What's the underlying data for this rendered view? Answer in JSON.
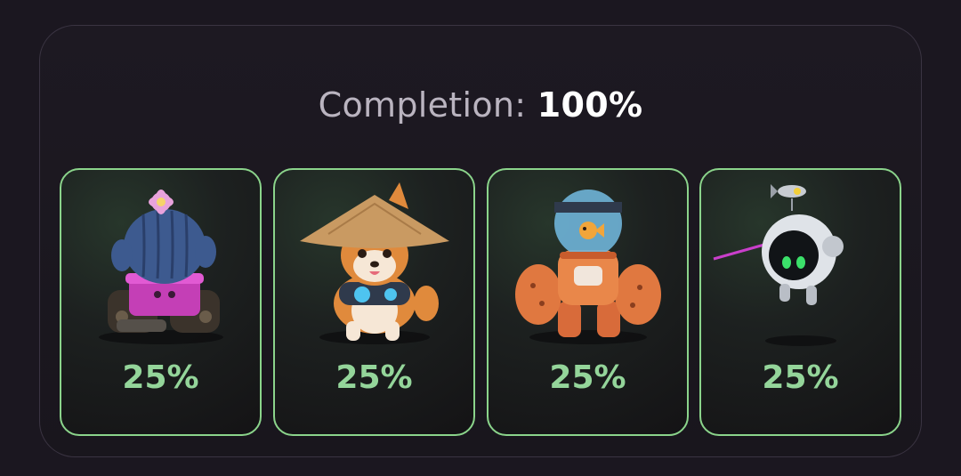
{
  "completion": {
    "label": "Completion:",
    "value": "100%"
  },
  "cards": [
    {
      "name": "cactus-tank",
      "percent": "25%"
    },
    {
      "name": "shiba-dog",
      "percent": "25%"
    },
    {
      "name": "fishbowl-mech",
      "percent": "25%"
    },
    {
      "name": "orb-robot",
      "percent": "25%"
    }
  ],
  "colors": {
    "accent_green": "#94d59a",
    "card_border": "#8bd48b",
    "background": "#1b1720"
  }
}
